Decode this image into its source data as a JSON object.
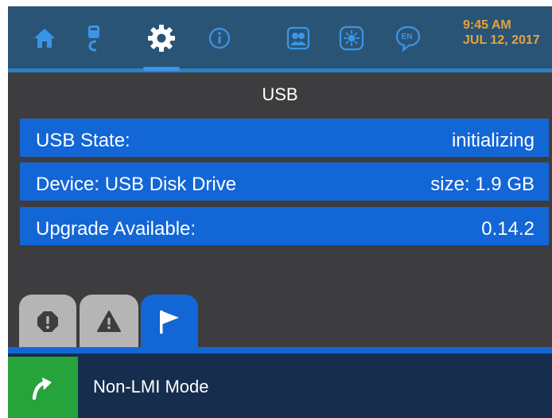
{
  "topbar": {
    "nav": [
      {
        "name": "home-icon"
      },
      {
        "name": "probe-icon"
      },
      {
        "name": "gear-icon",
        "active": true
      },
      {
        "name": "info-icon"
      },
      {
        "name": "users-icon"
      },
      {
        "name": "brightness-icon"
      },
      {
        "name": "language-icon",
        "label": "EN"
      }
    ],
    "time": "9:45 AM",
    "date": "JUL 12, 2017"
  },
  "page": {
    "title": "USB"
  },
  "rows": [
    {
      "label": "USB State:",
      "value": "initializing"
    },
    {
      "label": "Device: USB Disk Drive",
      "value": "size: 1.9 GB"
    },
    {
      "label": "Upgrade Available:",
      "value": "0.14.2"
    }
  ],
  "tabs": [
    {
      "name": "tab-errors",
      "icon": "alert-circle-icon",
      "active": false
    },
    {
      "name": "tab-warnings",
      "icon": "warning-triangle-icon",
      "active": false
    },
    {
      "name": "tab-notifications",
      "icon": "flag-icon",
      "active": true
    }
  ],
  "status": {
    "mode_label": "Non-LMI Mode",
    "mode_icon": "curved-arrow-icon"
  },
  "colors": {
    "topbar": "#2a5476",
    "accent": "#1366d6",
    "time_text": "#e7a33a",
    "background": "#3d3d3f",
    "statusbar": "#162d4d",
    "mode_icon_bg": "#26a33a"
  }
}
